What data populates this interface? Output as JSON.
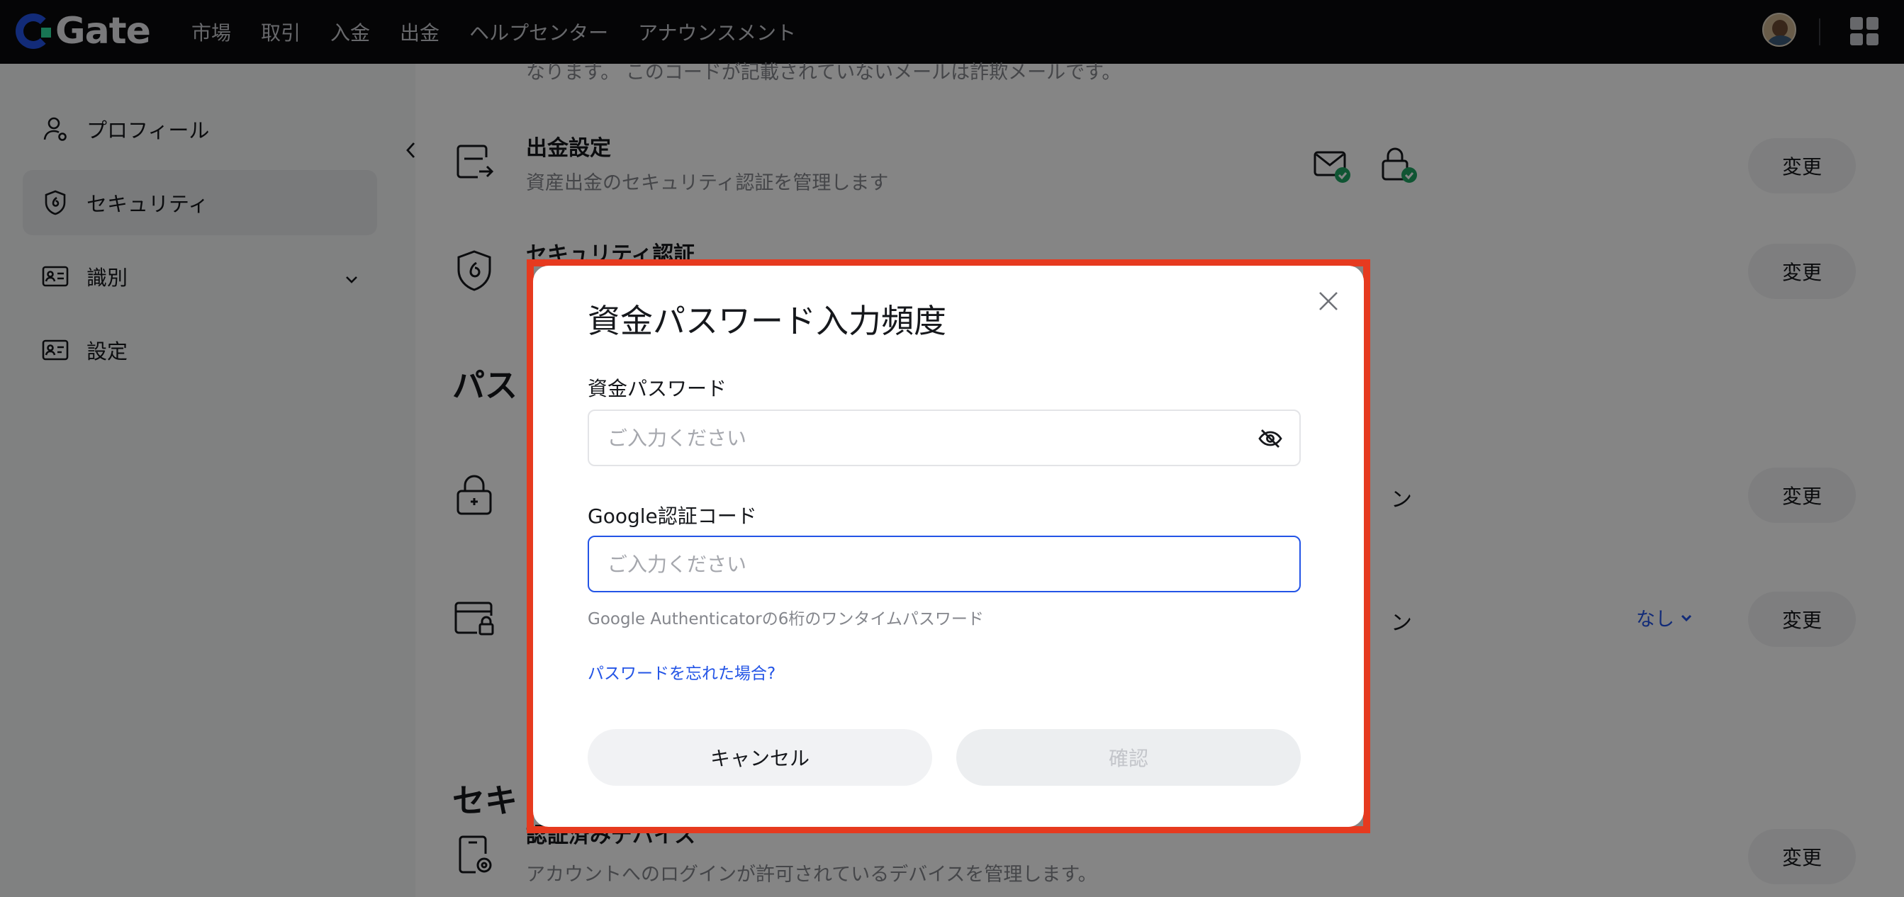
{
  "topbar": {
    "logo_text": "Gate",
    "nav": [
      "市場",
      "取引",
      "入金",
      "出金",
      "ヘルプセンター",
      "アナウンスメント"
    ]
  },
  "sidebar": {
    "items": [
      {
        "label": "プロフィール",
        "icon": "user-icon"
      },
      {
        "label": "セキュリティ",
        "icon": "shield-icon",
        "active": true
      },
      {
        "label": "識別",
        "icon": "id-card-icon",
        "expandable": true
      },
      {
        "label": "設定",
        "icon": "settings-card-icon"
      }
    ]
  },
  "main": {
    "top_partial_text": "なります。 このコードが記載されていないメールは詐欺メールです。",
    "withdraw": {
      "title": "出金設定",
      "desc": "資産出金のセキュリティ認証を管理します",
      "change": "変更"
    },
    "security_auth": {
      "title": "セキュリティ認証",
      "change": "変更"
    },
    "password_section_partial": "パス",
    "row_lock": {
      "trail": "ン",
      "change": "変更"
    },
    "row_card": {
      "trail": "ン",
      "dropdown": "なし",
      "change": "変更"
    },
    "security_section_partial": "セキ",
    "devices": {
      "title": "認証済みデバイス",
      "desc": "アカウントへのログインが許可されているデバイスを管理します。",
      "change": "変更"
    }
  },
  "modal": {
    "title": "資金パスワード入力頻度",
    "fund_password": {
      "label": "資金パスワード",
      "placeholder": "ご入力ください"
    },
    "google_code": {
      "label": "Google認証コード",
      "placeholder": "ご入力ください",
      "hint": "Google Authenticatorの6桁のワンタイムパスワード"
    },
    "forgot_link": "パスワードを忘れた場合?",
    "cancel": "キャンセル",
    "confirm": "確認"
  },
  "colors": {
    "accent": "#2354e6",
    "highlight_border": "#e63a1f",
    "success": "#1fa463"
  }
}
